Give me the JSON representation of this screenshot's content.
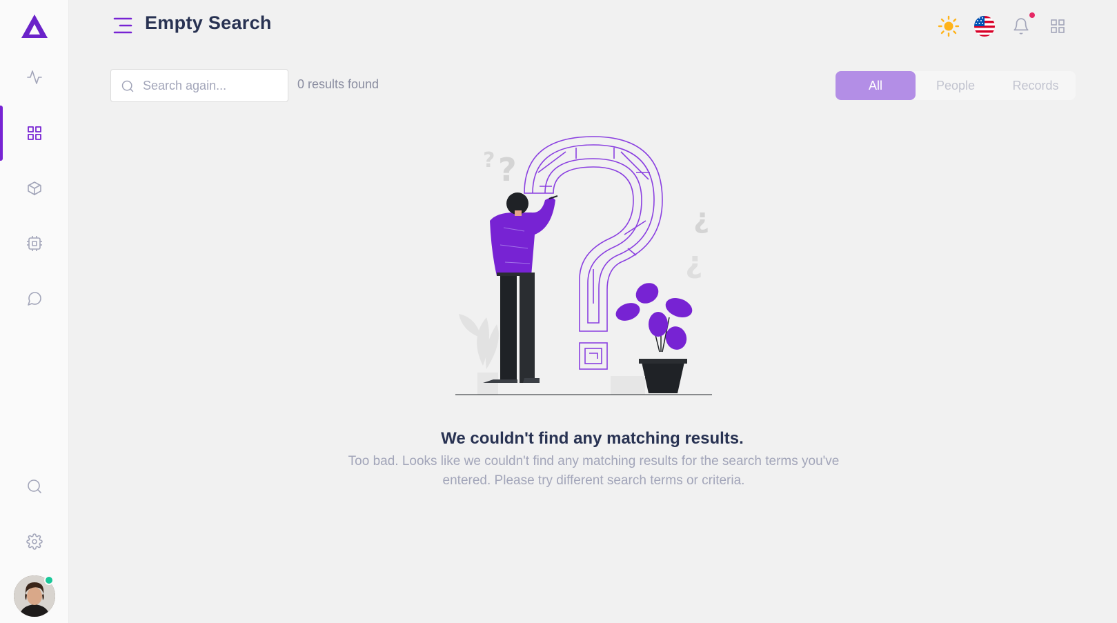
{
  "header": {
    "title": "Empty Search"
  },
  "search": {
    "placeholder": "Search again...",
    "value": "",
    "results_count": "0 results found"
  },
  "filter_tabs": [
    {
      "label": "All",
      "active": true
    },
    {
      "label": "People",
      "active": false
    },
    {
      "label": "Records",
      "active": false
    }
  ],
  "empty_state": {
    "title": "We couldn't find any matching results.",
    "text": "Too bad. Looks like we couldn't find any matching results for the search terms you've entered. Please try different search terms or criteria."
  },
  "sidebar": {
    "items": [
      {
        "icon": "activity-icon",
        "active": false
      },
      {
        "icon": "grid-icon",
        "active": true
      },
      {
        "icon": "box-icon",
        "active": false
      },
      {
        "icon": "cpu-icon",
        "active": false
      },
      {
        "icon": "message-circle-icon",
        "active": false
      }
    ],
    "bottom_items": [
      {
        "icon": "search-icon"
      },
      {
        "icon": "settings-icon"
      }
    ],
    "user_status": "online"
  },
  "header_icons": [
    "sun-icon",
    "us-flag-icon",
    "bell-icon",
    "apps-grid-icon"
  ],
  "colors": {
    "accent": "#7723d3",
    "tab_active": "#b38ee6",
    "notification": "#e62965",
    "online": "#19c799",
    "sun": "#ffb31a"
  }
}
